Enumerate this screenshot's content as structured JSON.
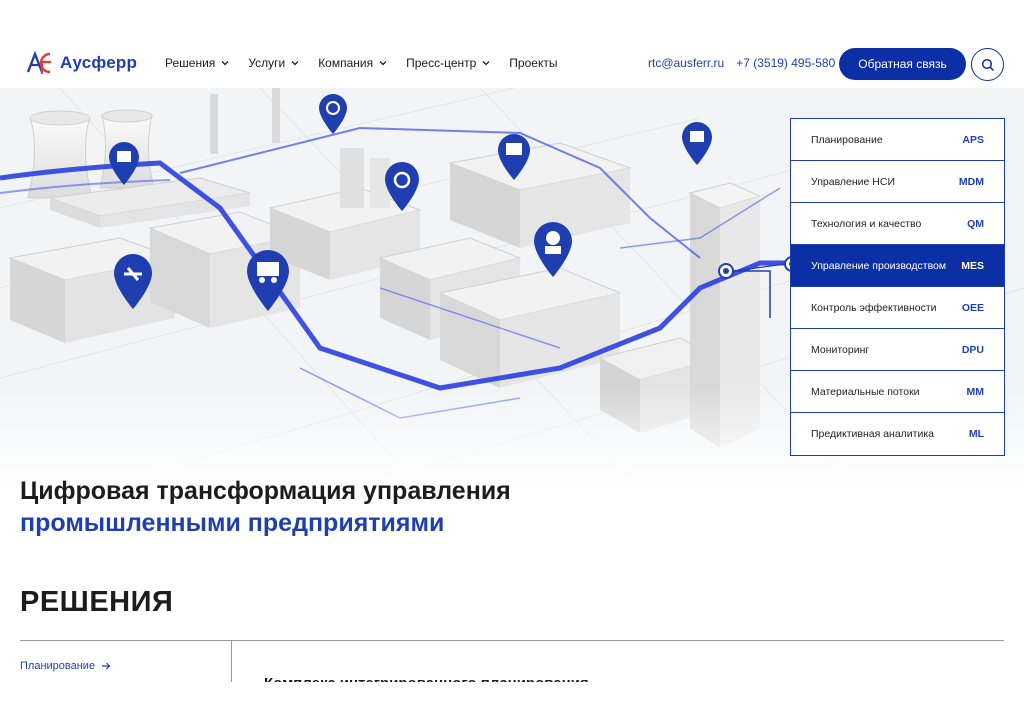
{
  "header": {
    "logo_text": "Аусферр",
    "nav": [
      {
        "label": "Решения",
        "has_dropdown": true
      },
      {
        "label": "Услуги",
        "has_dropdown": true
      },
      {
        "label": "Компания",
        "has_dropdown": true
      },
      {
        "label": "Пресс-центр",
        "has_dropdown": true
      },
      {
        "label": "Проекты",
        "has_dropdown": false
      }
    ],
    "email": "rtc@ausferr.ru",
    "phone": "+7 (3519) 495-580",
    "cta_label": "Обратная связь"
  },
  "solutions_panel": {
    "items": [
      {
        "label": "Планирование",
        "code": "APS",
        "active": false
      },
      {
        "label": "Управление НСИ",
        "code": "MDM",
        "active": false
      },
      {
        "label": "Технология и качество",
        "code": "QM",
        "active": false
      },
      {
        "label": "Управление производством",
        "code": "MES",
        "active": true
      },
      {
        "label": "Контроль эффективности",
        "code": "OEE",
        "active": false
      },
      {
        "label": "Мониторинг",
        "code": "DPU",
        "active": false
      },
      {
        "label": "Материальные потоки",
        "code": "MM",
        "active": false
      },
      {
        "label": "Предиктивная аналитика",
        "code": "ML",
        "active": false
      }
    ]
  },
  "hero": {
    "title_line1": "Цифровая трансформация управления",
    "title_line2": "промышленными предприятиями"
  },
  "solutions_section": {
    "title": "РЕШЕНИЯ",
    "side_link": "Планирование",
    "sub_heading": "Комплекс интегрированного планирования"
  },
  "colors": {
    "brand": "#1f3fb0",
    "brand_dark": "#0c2fa6",
    "logo_red": "#e03a3a"
  },
  "icons": [
    "logo-mark-icon",
    "chevron-down-icon",
    "search-icon",
    "arrow-right-icon",
    "map-pin-icon"
  ]
}
